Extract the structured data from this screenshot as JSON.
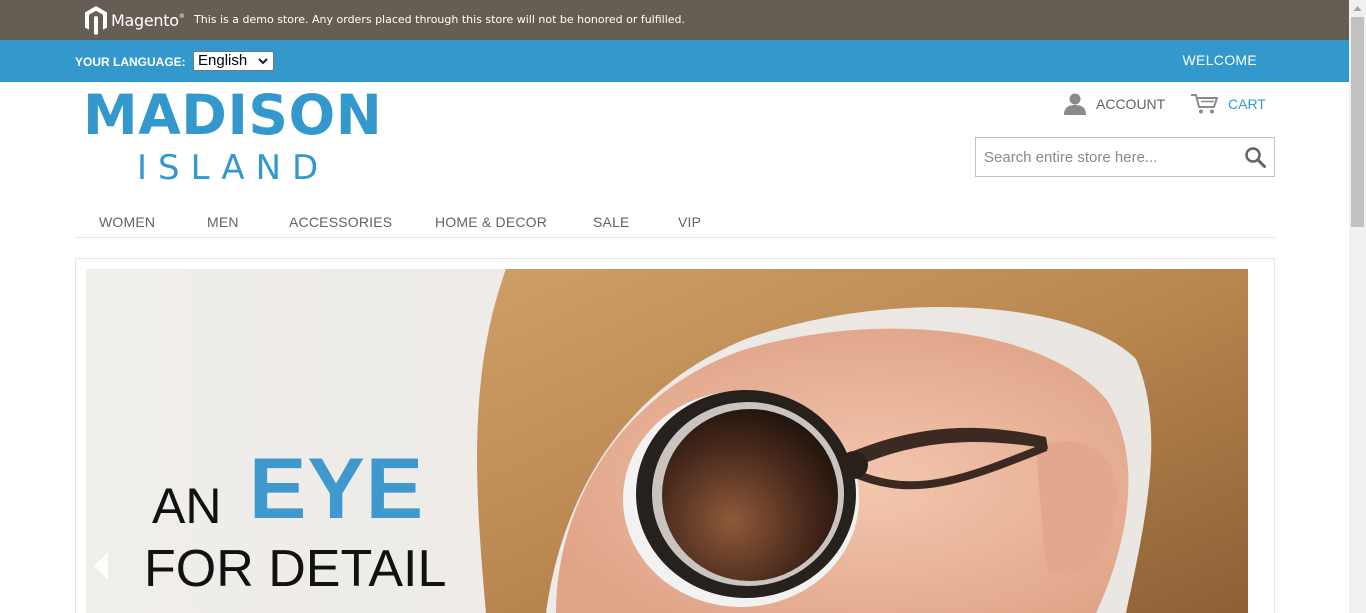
{
  "demo_notice": {
    "logo_text": "Magento",
    "message": "This is a demo store. Any orders placed through this store will not be honored or fulfilled."
  },
  "language_bar": {
    "label": "YOUR LANGUAGE:",
    "selected": "English",
    "welcome": "WELCOME"
  },
  "header": {
    "brand_line1": "MADISON",
    "brand_line2": "ISLAND",
    "account_label": "ACCOUNT",
    "cart_label": "CART",
    "search_placeholder": "Search entire store here..."
  },
  "nav": {
    "items": [
      {
        "label": "WOMEN"
      },
      {
        "label": "MEN"
      },
      {
        "label": "ACCESSORIES"
      },
      {
        "label": "HOME & DECOR"
      },
      {
        "label": "SALE"
      },
      {
        "label": "VIP"
      }
    ]
  },
  "slide": {
    "headline_an": "AN",
    "headline_eye": "EYE",
    "headline_detail": "FOR DETAIL"
  },
  "colors": {
    "demo_bar": "#675e53",
    "accent": "#3399cc",
    "text": "#636363"
  },
  "icons": [
    "magento-logo-icon",
    "chevron-down-icon",
    "user-icon",
    "cart-icon",
    "search-icon",
    "arrow-left-icon"
  ]
}
